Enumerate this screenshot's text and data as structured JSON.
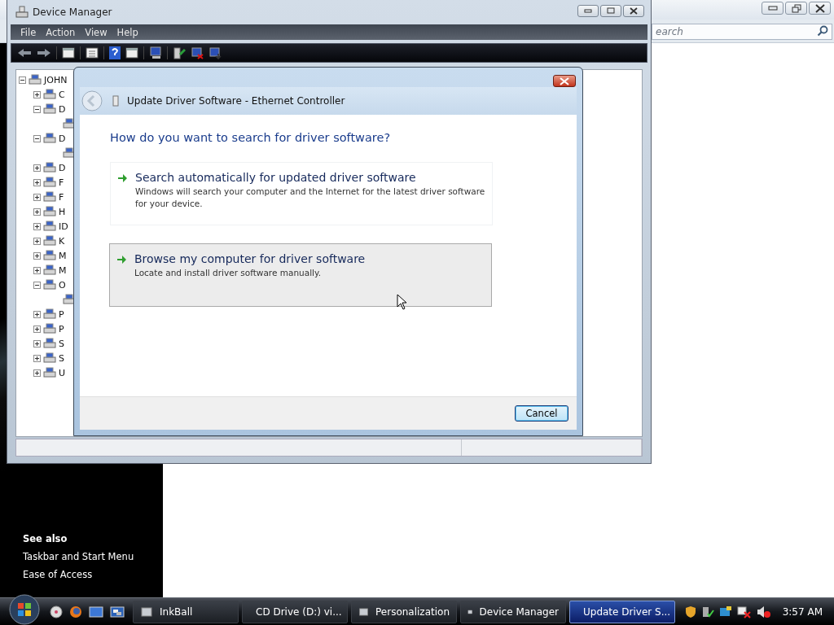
{
  "back_window": {
    "search": {
      "placeholder": "earch"
    },
    "see_also": {
      "heading": "See also",
      "links": [
        "Taskbar and Start Menu",
        "Ease of Access"
      ]
    }
  },
  "device_manager": {
    "title": "Device Manager",
    "menu": [
      "File",
      "Action",
      "View",
      "Help"
    ],
    "tree": {
      "label": "JOHN",
      "expanded": true,
      "children": [
        {
          "label": "C",
          "expanded": false
        },
        {
          "label": "D",
          "expanded": true,
          "children": [
            {
              "kind": "device"
            }
          ]
        },
        {
          "label": "D",
          "expanded": true,
          "children": [
            {
              "kind": "device"
            }
          ]
        },
        {
          "label": "D",
          "expanded": false
        },
        {
          "label": "F",
          "expanded": false
        },
        {
          "label": "F",
          "expanded": false
        },
        {
          "label": "H",
          "expanded": false
        },
        {
          "label": "ID",
          "expanded": false
        },
        {
          "label": "K",
          "expanded": false
        },
        {
          "label": "M",
          "expanded": false
        },
        {
          "label": "M",
          "expanded": false
        },
        {
          "label": "O",
          "expanded": true,
          "children": [
            {
              "kind": "device"
            }
          ]
        },
        {
          "label": "P",
          "expanded": false
        },
        {
          "label": "P",
          "expanded": false
        },
        {
          "label": "S",
          "expanded": false
        },
        {
          "label": "S",
          "expanded": false
        },
        {
          "label": "U",
          "expanded": false
        }
      ]
    }
  },
  "dialog": {
    "title": "Update Driver Software - Ethernet Controller",
    "heading": "How do you want to search for driver software?",
    "options": [
      {
        "title": "Search automatically for updated driver software",
        "description": "Windows will search your computer and the Internet for the latest driver software for your device.",
        "selected": false
      },
      {
        "title": "Browse my computer for driver software",
        "description": "Locate and install driver software manually.",
        "selected": true
      }
    ],
    "buttons": [
      "Cancel"
    ]
  },
  "taskbar": {
    "tasks": [
      {
        "label": "InkBall",
        "selected": false
      },
      {
        "label": "CD Drive (D:) vi...",
        "selected": false
      },
      {
        "label": "Personalization",
        "selected": false
      },
      {
        "label": "Device Manager",
        "selected": false
      },
      {
        "label": "Update Driver S...",
        "selected": true
      }
    ],
    "clock": "3:57 AM"
  }
}
